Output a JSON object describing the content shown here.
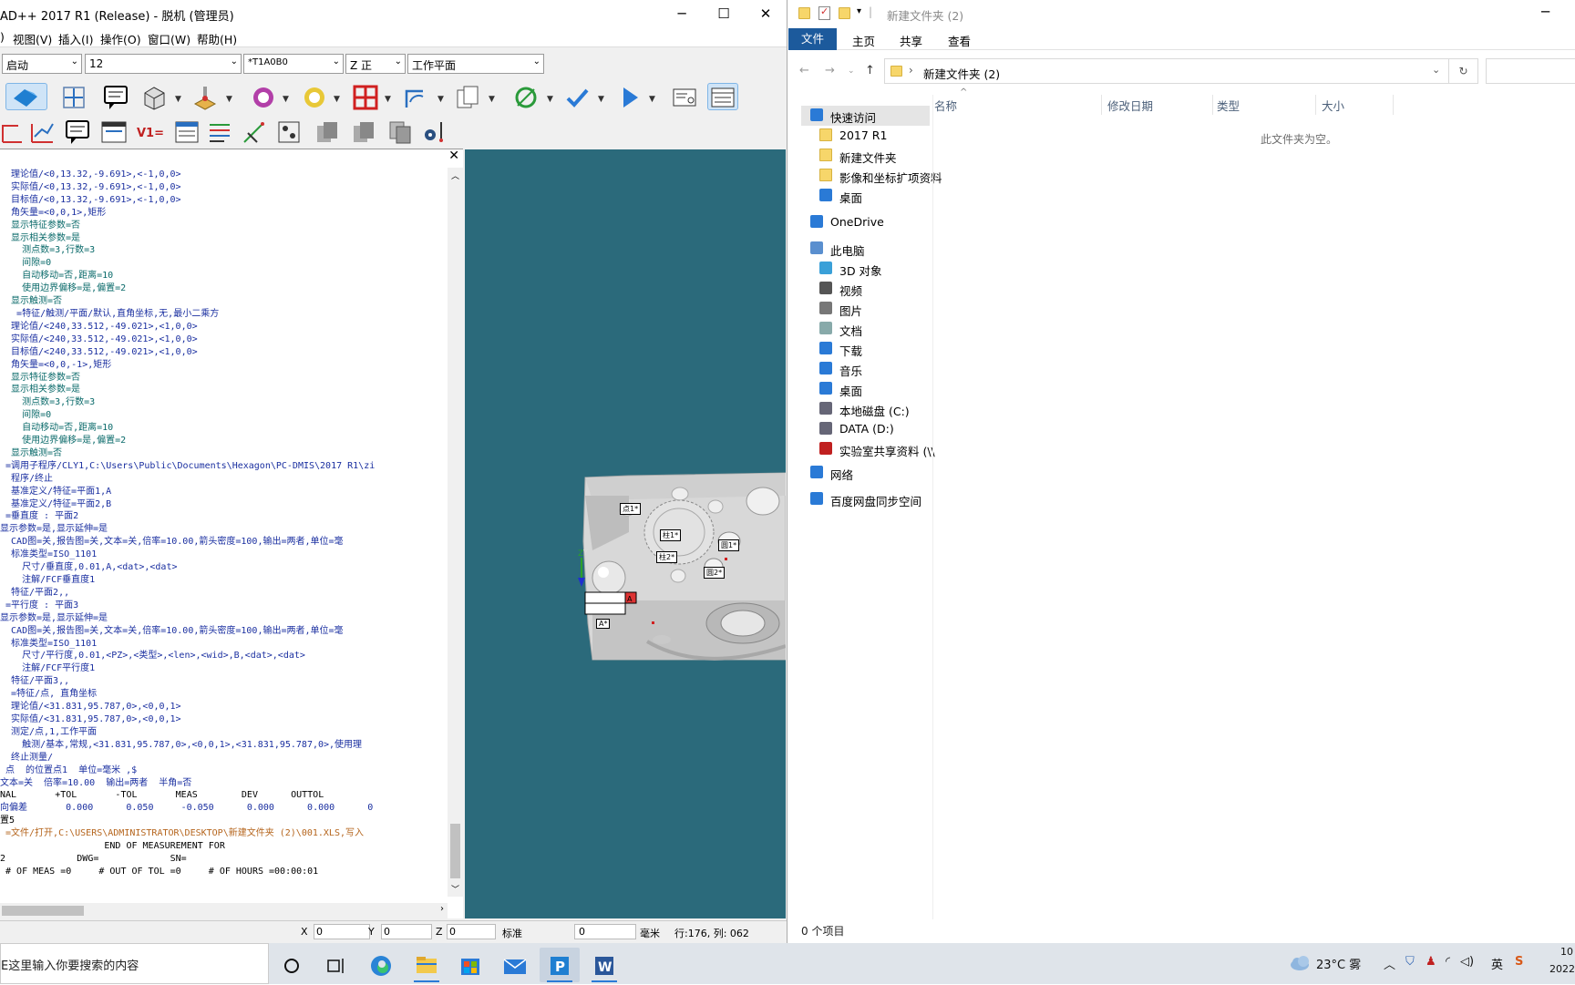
{
  "left_window": {
    "title": "AD++ 2017 R1 (Release) - 脱机 (管理员)",
    "menu": [
      "视图(V)",
      "插入(I)",
      "操作(O)",
      "窗口(W)",
      "帮助(H)"
    ],
    "menu_prefix": ")",
    "combos": {
      "mode": "启动",
      "probe_size": "12",
      "tip": "*T1A0B0",
      "view_axis": "Z 正",
      "plane": "工作平面"
    },
    "code": [
      {
        "t": "  理论值/<0,13.32,-9.691>,<-1,0,0>",
        "k": "v"
      },
      {
        "t": "  实际值/<0,13.32,-9.691>,<-1,0,0>",
        "k": "v"
      },
      {
        "t": "  目标值/<0,13.32,-9.691>,<-1,0,0>",
        "k": "v"
      },
      {
        "t": "  角矢量=<0,0,1>,矩形",
        "k": "v"
      },
      {
        "t": "  显示特征参数=否",
        "k": "c"
      },
      {
        "t": "  显示相关参数=是",
        "k": "c"
      },
      {
        "t": "    测点数=3,行数=3",
        "k": "c"
      },
      {
        "t": "    间隙=0",
        "k": "c"
      },
      {
        "t": "    自动移动=否,距离=10",
        "k": "c"
      },
      {
        "t": "    使用边界偏移=是,偏置=2",
        "k": "c"
      },
      {
        "t": "  显示触测=否",
        "k": "c"
      },
      {
        "t": "   =特征/触测/平面/默认,直角坐标,无,最小二乘方",
        "k": "v"
      },
      {
        "t": "  理论值/<240,33.512,-49.021>,<1,0,0>",
        "k": "v"
      },
      {
        "t": "  实际值/<240,33.512,-49.021>,<1,0,0>",
        "k": "v"
      },
      {
        "t": "  目标值/<240,33.512,-49.021>,<1,0,0>",
        "k": "v"
      },
      {
        "t": "  角矢量=<0,0,-1>,矩形",
        "k": "v"
      },
      {
        "t": "  显示特征参数=否",
        "k": "c"
      },
      {
        "t": "  显示相关参数=是",
        "k": "c"
      },
      {
        "t": "    测点数=3,行数=3",
        "k": "c"
      },
      {
        "t": "    间隙=0",
        "k": "c"
      },
      {
        "t": "    自动移动=否,距离=10",
        "k": "c"
      },
      {
        "t": "    使用边界偏移=是,偏置=2",
        "k": "c"
      },
      {
        "t": "  显示触测=否",
        "k": "c"
      },
      {
        "t": " =调用子程序/CLY1,C:\\Users\\Public\\Documents\\Hexagon\\PC-DMIS\\2017 R1\\zi",
        "k": "v"
      },
      {
        "t": "  程序/终止",
        "k": "v"
      },
      {
        "t": "  基准定义/特征=平面1,A",
        "k": "v"
      },
      {
        "t": "  基准定义/特征=平面2,B",
        "k": "v"
      },
      {
        "t": " =垂直度 : 平面2",
        "k": "v"
      },
      {
        "t": "显示参数=是,显示延伸=是",
        "k": "v"
      },
      {
        "t": "  CAD图=关,报告图=关,文本=关,倍率=10.00,箭头密度=100,输出=两者,单位=毫",
        "k": "v"
      },
      {
        "t": "  标准类型=ISO_1101",
        "k": "v"
      },
      {
        "t": "    尺寸/垂直度,0.01,A,<dat>,<dat>",
        "k": "v"
      },
      {
        "t": "    注解/FCF垂直度1",
        "k": "v"
      },
      {
        "t": "  特征/平面2,,",
        "k": "v"
      },
      {
        "t": " =平行度 : 平面3",
        "k": "v"
      },
      {
        "t": "显示参数=是,显示延伸=是",
        "k": "v"
      },
      {
        "t": "  CAD图=关,报告图=关,文本=关,倍率=10.00,箭头密度=100,输出=两者,单位=毫",
        "k": "v"
      },
      {
        "t": "  标准类型=ISO_1101",
        "k": "v"
      },
      {
        "t": "    尺寸/平行度,0.01,<PZ>,<类型>,<len>,<wid>,B,<dat>,<dat>",
        "k": "v"
      },
      {
        "t": "    注解/FCF平行度1",
        "k": "v"
      },
      {
        "t": "  特征/平面3,,",
        "k": "v"
      },
      {
        "t": "  =特征/点, 直角坐标",
        "k": "v"
      },
      {
        "t": "  理论值/<31.831,95.787,0>,<0,0,1>",
        "k": "v"
      },
      {
        "t": "  实际值/<31.831,95.787,0>,<0,0,1>",
        "k": "v"
      },
      {
        "t": "  测定/点,1,工作平面",
        "k": "v"
      },
      {
        "t": "    触测/基本,常规,<31.831,95.787,0>,<0,0,1>,<31.831,95.787,0>,使用理",
        "k": "v"
      },
      {
        "t": "  终止测量/",
        "k": "v"
      },
      {
        "t": " 点  的位置点1  单位=毫米 ,$",
        "k": "v"
      },
      {
        "t": "文本=关  倍率=10.00  输出=两者  半角=否",
        "k": "v"
      },
      {
        "t": "NAL       +TOL       -TOL       MEAS        DEV      OUTTOL",
        "k": "n"
      },
      {
        "t": "向偏差       0.000      0.050     -0.050      0.000      0.000      0",
        "k": "v"
      },
      {
        "t": "置5",
        "k": "n"
      },
      {
        "t": " =文件/打开,C:\\USERS\\ADMINISTRATOR\\DESKTOP\\新建文件夹 (2)\\001.XLS,写入",
        "k": "o"
      },
      {
        "t": "                   END OF MEASUREMENT FOR",
        "k": "n"
      },
      {
        "t": "2             DWG=             SN=",
        "k": "n"
      },
      {
        "t": " # OF MEAS =0     # OUT OF TOL =0     # OF HOURS =00:00:01",
        "k": "n"
      }
    ],
    "status": {
      "x_label": "X",
      "x_val": "0",
      "y_label": "Y",
      "y_val": "0",
      "z_label": "Z",
      "z_val": "0",
      "mode": "标准",
      "mode_val": "0",
      "units": "毫米",
      "row_col": "行:176, 列: 062"
    },
    "cad_labels": [
      "点1*",
      "柱1*",
      "圆1*",
      "柱2*",
      "圆2*",
      "A*"
    ]
  },
  "right_window": {
    "title": "新建文件夹 (2)",
    "ribbon_tabs": [
      "文件",
      "主页",
      "共享",
      "查看"
    ],
    "address": "新建文件夹 (2)",
    "nav": [
      {
        "label": "快速访问",
        "icon": "star-icon",
        "level": 0
      },
      {
        "label": "2017 R1",
        "icon": "folder-icon",
        "level": 1
      },
      {
        "label": "新建文件夹",
        "icon": "folder-icon",
        "level": 1
      },
      {
        "label": "影像和坐标扩项资料",
        "icon": "folder-icon",
        "level": 1
      },
      {
        "label": "桌面",
        "icon": "desktop-icon",
        "level": 1
      },
      {
        "label": "OneDrive",
        "icon": "cloud-icon",
        "level": 0
      },
      {
        "label": "此电脑",
        "icon": "pc-icon",
        "level": 0
      },
      {
        "label": "3D 对象",
        "icon": "cube-icon",
        "level": 1
      },
      {
        "label": "视频",
        "icon": "video-icon",
        "level": 1
      },
      {
        "label": "图片",
        "icon": "picture-icon",
        "level": 1
      },
      {
        "label": "文档",
        "icon": "document-icon",
        "level": 1
      },
      {
        "label": "下载",
        "icon": "download-icon",
        "level": 1
      },
      {
        "label": "音乐",
        "icon": "music-icon",
        "level": 1
      },
      {
        "label": "桌面",
        "icon": "desktop-icon",
        "level": 1
      },
      {
        "label": "本地磁盘 (C:)",
        "icon": "drive-icon",
        "level": 1
      },
      {
        "label": "DATA (D:)",
        "icon": "drive-icon",
        "level": 1
      },
      {
        "label": "实验室共享资料 (\\\\",
        "icon": "network-drive-icon",
        "level": 1
      },
      {
        "label": "网络",
        "icon": "network-icon",
        "level": 0
      },
      {
        "label": "百度网盘同步空间",
        "icon": "baidu-icon",
        "level": 0
      }
    ],
    "columns": [
      "名称",
      "修改日期",
      "类型",
      "大小"
    ],
    "empty_text": "此文件夹为空。",
    "status": "0 个项目"
  },
  "taskbar": {
    "search_placeholder": "E这里输入你要搜索的内容",
    "weather": "23°C 雾",
    "ime": "英",
    "clock_time": "10",
    "clock_date": "2022"
  },
  "colors": {
    "cad_background": "#2b6a7b",
    "explorer_file_tab": "#1c5a9c",
    "code_value": "#1a2fa0",
    "code_cyan": "#0a6a6a",
    "code_orange": "#b5651d"
  }
}
